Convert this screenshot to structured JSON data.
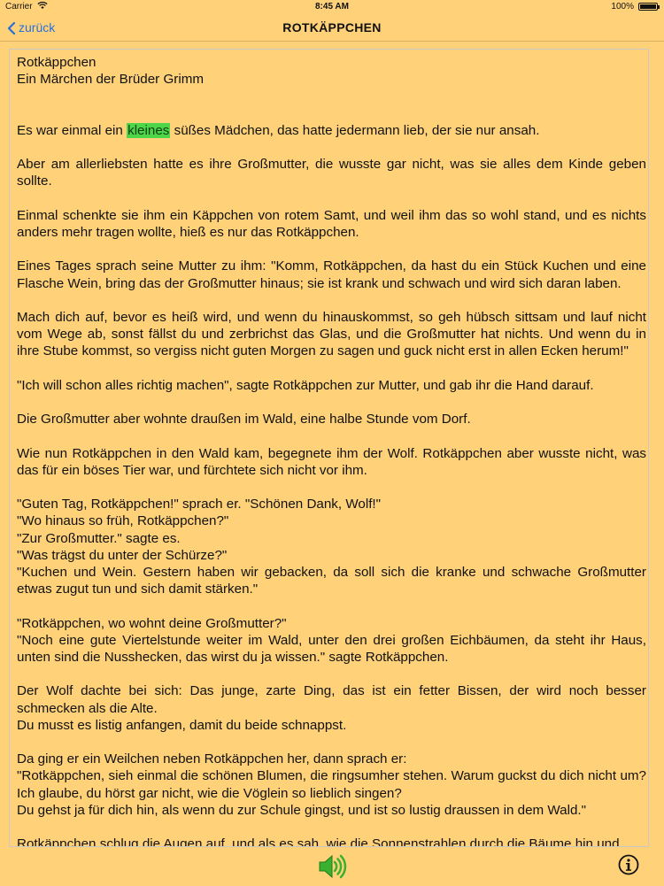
{
  "status_bar": {
    "carrier": "Carrier",
    "time": "8:45 AM",
    "battery": "100%"
  },
  "nav": {
    "back_label": "zurück",
    "title": "ROTKÄPPCHEN"
  },
  "story": {
    "title_line1": "Rotkäppchen",
    "title_line2": "Ein Märchen der Brüder Grimm",
    "highlighted_word": "kleines",
    "p1_before": "Es war einmal ein ",
    "p1_after": " süßes Mädchen, das hatte jedermann lieb, der sie nur ansah.",
    "p2": "Aber am allerliebsten hatte es ihre Großmutter, die wusste gar nicht, was sie alles dem Kinde geben sollte.",
    "p3": "Einmal schenkte sie ihm ein Käppchen von rotem Samt, und weil ihm das so wohl stand, und es nichts anders mehr tragen wollte, hieß es nur das Rotkäppchen.",
    "p4": "Eines Tages sprach seine Mutter zu ihm: \"Komm, Rotkäppchen, da hast du ein Stück Kuchen und eine Flasche Wein, bring das der Großmutter hinaus; sie ist krank und schwach und wird sich daran laben.",
    "p5": "Mach dich auf, bevor es heiß wird, und wenn du hinauskommst, so geh hübsch sittsam und lauf nicht vom Wege ab, sonst fällst du und zerbrichst das Glas, und die Großmutter hat nichts. Und wenn du in ihre Stube kommst, so vergiss nicht guten Morgen zu sagen und guck nicht erst in allen Ecken herum!\"",
    "p6": "\"Ich will schon alles richtig machen\", sagte Rotkäppchen zur Mutter, und gab ihr die Hand darauf.",
    "p7": "Die Großmutter aber wohnte draußen im Wald, eine halbe Stunde vom Dorf.",
    "p8": "Wie nun Rotkäppchen in den Wald kam, begegnete ihm der Wolf. Rotkäppchen aber wusste nicht, was das für ein böses Tier war, und fürchtete sich nicht vor ihm.",
    "p9_l1": "\"Guten Tag, Rotkäppchen!\" sprach er. \"Schönen Dank, Wolf!\"",
    "p9_l2": "\"Wo hinaus so früh, Rotkäppchen?\"",
    "p9_l3": "\"Zur Großmutter.\" sagte es.",
    "p9_l4": "\"Was trägst du unter der Schürze?\"",
    "p9_l5": "\"Kuchen und Wein. Gestern haben wir gebacken, da soll sich die kranke und schwache Großmutter etwas zugut tun und sich damit stärken.\"",
    "p10_l1": "\"Rotkäppchen, wo wohnt deine Großmutter?\"",
    "p10_l2": "\"Noch eine gute Viertelstunde weiter im Wald, unter den drei großen Eichbäumen, da steht ihr Haus, unten sind die Nusshecken, das wirst du ja wissen.\" sagte Rotkäppchen.",
    "p11_l1": "Der Wolf dachte bei sich: Das junge, zarte Ding, das ist ein fetter Bissen, der wird noch besser schmecken als die Alte.",
    "p11_l2": "Du musst es listig anfangen, damit du beide schnappst.",
    "p12_l1": "Da ging er ein Weilchen neben Rotkäppchen her, dann sprach er:",
    "p12_l2": "\"Rotkäppchen, sieh einmal die schönen Blumen, die ringsumher stehen. Warum guckst du dich nicht um? Ich glaube, du hörst gar nicht, wie die Vöglein so lieblich singen?",
    "p12_l3": "Du gehst ja für dich hin, als wenn du zur Schule gingst, und ist so lustig draussen in dem Wald.\"",
    "p13": "Rotkäppchen schlug die Augen auf, und als es sah, wie die Sonnenstrahlen durch die Bäume hin und"
  },
  "colors": {
    "background": "#ffd27a",
    "highlight": "#4ed64a",
    "accent": "#2a6fd6"
  },
  "icons": {
    "speaker": "speaker-icon",
    "info": "info-icon",
    "back": "chevron-left-icon"
  }
}
